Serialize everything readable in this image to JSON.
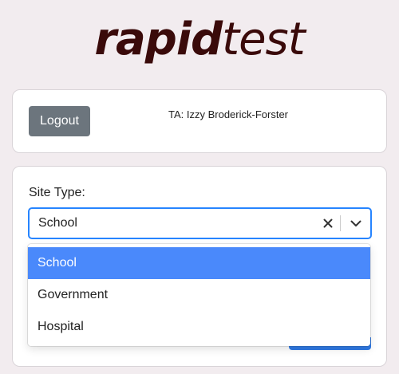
{
  "logo": {
    "bold": "rapid",
    "light": "test"
  },
  "header_card": {
    "logout_label": "Logout",
    "ta_text": "TA: Izzy Broderick-Forster"
  },
  "form": {
    "site_type_label": "Site Type:",
    "site_type_value": "School",
    "options": [
      {
        "label": "School",
        "selected": true
      },
      {
        "label": "Government",
        "selected": false
      },
      {
        "label": "Hospital",
        "selected": false
      }
    ]
  },
  "colors": {
    "background": "#f2ecef",
    "logo": "#3a0a0a",
    "logout_button": "#6c757d",
    "focus_border": "#2684ff",
    "selected_option": "#4a89fb"
  },
  "icons": {
    "clear": "close-icon",
    "dropdown": "chevron-down-icon"
  }
}
